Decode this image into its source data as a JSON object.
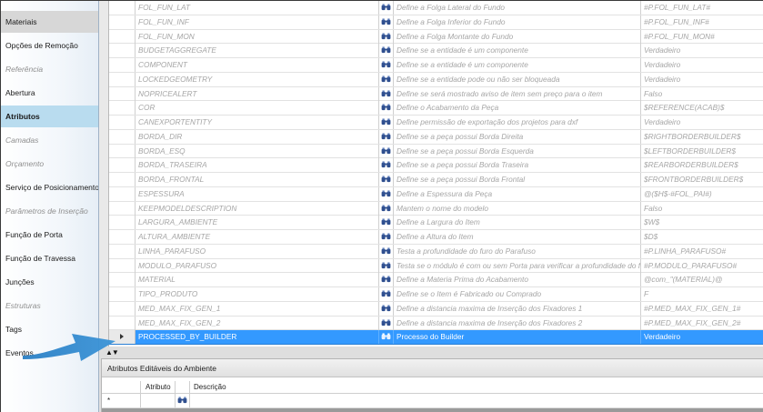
{
  "sidebar": {
    "items": [
      {
        "label": "Materiais",
        "state": "selected-gray"
      },
      {
        "label": "Opções de Remoção",
        "state": "normal"
      },
      {
        "label": "Referência",
        "state": "disabled"
      },
      {
        "label": "Abertura",
        "state": "normal"
      },
      {
        "label": "Atributos",
        "state": "selected-blue"
      },
      {
        "label": "Camadas",
        "state": "disabled"
      },
      {
        "label": "Orçamento",
        "state": "disabled"
      },
      {
        "label": "Serviço de Posicionamento",
        "state": "normal"
      },
      {
        "label": "Parâmetros de Inserção",
        "state": "disabled"
      },
      {
        "label": "Função de Porta",
        "state": "normal"
      },
      {
        "label": "Função de Travessa",
        "state": "normal"
      },
      {
        "label": "Junções",
        "state": "normal"
      },
      {
        "label": "Estruturas",
        "state": "disabled"
      },
      {
        "label": "Tags",
        "state": "normal"
      },
      {
        "label": "Eventos",
        "state": "normal"
      }
    ]
  },
  "grid": {
    "rows": [
      {
        "name": "FOL_FUN_LAT",
        "description": "Define a Folga Lateral do Fundo",
        "value": "#P.FOL_FUN_LAT#"
      },
      {
        "name": "FOL_FUN_INF",
        "description": "Define a Folga Inferior do Fundo",
        "value": "#P.FOL_FUN_INF#"
      },
      {
        "name": "FOL_FUN_MON",
        "description": "Define a Folga Montante do Fundo",
        "value": "#P.FOL_FUN_MON#"
      },
      {
        "name": "BUDGETAGGREGATE",
        "description": "Define se a entidade é um componente",
        "value": "Verdadeiro"
      },
      {
        "name": "COMPONENT",
        "description": "Define se a entidade é um componente",
        "value": "Verdadeiro"
      },
      {
        "name": "LOCKEDGEOMETRY",
        "description": "Define se a entidade pode ou não ser bloqueada",
        "value": "Verdadeiro"
      },
      {
        "name": "NOPRICEALERT",
        "description": "Define se será mostrado aviso de item sem preço para o item",
        "value": "Falso"
      },
      {
        "name": "COR",
        "description": "Define o Acabamento da Peça",
        "value": "$REFERENCE(ACAB)$"
      },
      {
        "name": "CANEXPORTENTITY",
        "description": "Define permissão de exportação dos projetos para dxf",
        "value": "Verdadeiro"
      },
      {
        "name": "BORDA_DIR",
        "description": "Define se a peça possui Borda Direita",
        "value": "$RIGHTBORDERBUILDER$"
      },
      {
        "name": "BORDA_ESQ",
        "description": "Define se a peça possui Borda Esquerda",
        "value": "$LEFTBORDERBUILDER$"
      },
      {
        "name": "BORDA_TRASEIRA",
        "description": "Define se a peça possui Borda Traseira",
        "value": "$REARBORDERBUILDER$"
      },
      {
        "name": "BORDA_FRONTAL",
        "description": "Define se a peça possui Borda Frontal",
        "value": "$FRONTBORDERBUILDER$"
      },
      {
        "name": "ESPESSURA",
        "description": "Define a Espessura da Peça",
        "value": "@($H$-#FOL_PAI#)"
      },
      {
        "name": "KEEPMODELDESCRIPTION",
        "description": "Mantem o nome do modelo",
        "value": "Falso"
      },
      {
        "name": "LARGURA_AMBIENTE",
        "description": "Define a Largura do Item",
        "value": "$W$"
      },
      {
        "name": "ALTURA_AMBIENTE",
        "description": "Define a Altura do Item",
        "value": "$D$"
      },
      {
        "name": "LINHA_PARAFUSO",
        "description": "Testa a profundidade do furo do Parafuso",
        "value": "#P.LINHA_PARAFUSO#"
      },
      {
        "name": "MODULO_PARAFUSO",
        "description": "Testa se o módulo é com ou sem Porta para verificar a profundidade do f...",
        "value": "#P.MODULO_PARAFUSO#"
      },
      {
        "name": "MATERIAL",
        "description": "Define a Materia Prima do Acabamento",
        "value": "@com_\"(MATERIAL)@"
      },
      {
        "name": "TIPO_PRODUTO",
        "description": "Define se o Item é Fabricado ou Comprado",
        "value": "F"
      },
      {
        "name": "MED_MAX_FIX_GEN_1",
        "description": "Define a distancia maxima de Inserção dos Fixadores 1",
        "value": "#P.MED_MAX_FIX_GEN_1#"
      },
      {
        "name": "MED_MAX_FIX_GEN_2",
        "description": "Define a distancia maxima de Inserção dos Fixadores 2",
        "value": "#P.MED_MAX_FIX_GEN_2#"
      },
      {
        "name": "PROCESSED_BY_BUILDER",
        "description": "Processo do Builder",
        "value": "Verdadeiro"
      }
    ]
  },
  "bottom": {
    "title": "Atributos Editáveis do Ambiente",
    "col_attr": "Atributo",
    "col_desc": "Descrição",
    "new_row_marker": "*"
  },
  "splitter": {
    "arrows": "▲▼"
  },
  "colors": {
    "selection": "#3399ff",
    "sidebar_selected": "#b9dcef",
    "arrow": "#2e86c9"
  }
}
